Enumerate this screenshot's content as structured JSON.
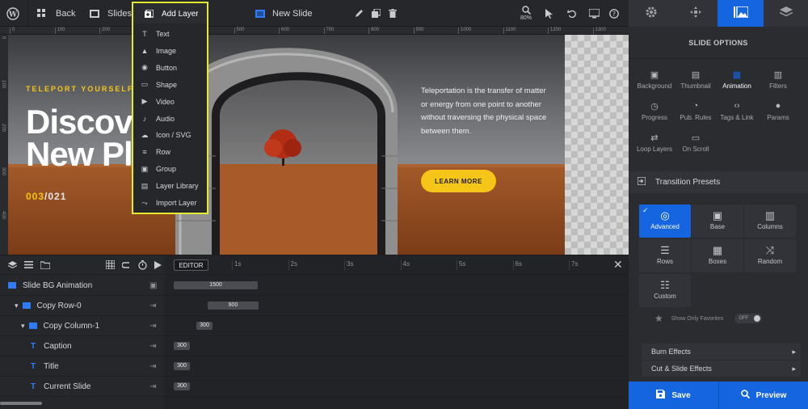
{
  "topbar": {
    "back_label": "Back",
    "slides_label": "Slides",
    "add_layer_label": "Add Layer",
    "new_slide_label": "New Slide",
    "zoom": "80%"
  },
  "ruler": {
    "h_ticks": [
      "0",
      "100",
      "200",
      "300",
      "400",
      "500",
      "600",
      "700",
      "800",
      "900",
      "1000",
      "1100",
      "1200",
      "1300"
    ],
    "v_ticks": [
      "0",
      "100",
      "200",
      "300",
      "400",
      "500"
    ]
  },
  "add_layer_menu": {
    "items": [
      {
        "label": "Text",
        "icon": "text-icon"
      },
      {
        "label": "Image",
        "icon": "image-icon"
      },
      {
        "label": "Button",
        "icon": "button-icon"
      },
      {
        "label": "Shape",
        "icon": "shape-icon"
      },
      {
        "label": "Video",
        "icon": "video-icon"
      },
      {
        "label": "Audio",
        "icon": "audio-icon"
      },
      {
        "label": "Icon / SVG",
        "icon": "icon-svg-icon"
      },
      {
        "label": "Row",
        "icon": "row-icon"
      },
      {
        "label": "Group",
        "icon": "group-icon"
      },
      {
        "label": "Layer Library",
        "icon": "layer-library-icon"
      },
      {
        "label": "Import Layer",
        "icon": "import-layer-icon"
      }
    ]
  },
  "slide": {
    "caption": "TELEPORT YOURSELF",
    "title_line1": "Discover",
    "title_line2": "New Places",
    "counter_current": "003",
    "counter_sep": "/",
    "counter_total": "021",
    "body_text": "Teleportation is the transfer of matter or energy from one point to another without traversing the physical space between them.",
    "cta_label": "LEARN MORE",
    "accent": "#f5c518"
  },
  "timeline": {
    "editor_label": "EDITOR",
    "ticks": [
      "1s",
      "2s",
      "3s",
      "4s",
      "5s",
      "6s",
      "7s"
    ],
    "layers": [
      {
        "name": "Slide BG Animation",
        "value": "1500"
      },
      {
        "name": "Copy Row-0",
        "value": "900"
      },
      {
        "name": "Copy Column-1",
        "value": "300"
      },
      {
        "name": "Caption",
        "value": "300"
      },
      {
        "name": "Title",
        "value": "300"
      },
      {
        "name": "Current Slide",
        "value": "300"
      }
    ]
  },
  "panel": {
    "section_title": "SLIDE OPTIONS",
    "options": [
      {
        "label": "Background",
        "icon": "background-icon"
      },
      {
        "label": "Thumbnail",
        "icon": "thumbnail-icon"
      },
      {
        "label": "Animation",
        "icon": "animation-icon",
        "active": true
      },
      {
        "label": "Filters",
        "icon": "filters-icon"
      },
      {
        "label": "Progress",
        "icon": "progress-icon"
      },
      {
        "label": "Pub. Rules",
        "icon": "pub-rules-icon"
      },
      {
        "label": "Tags & Link",
        "icon": "tags-link-icon"
      },
      {
        "label": "Params",
        "icon": "params-icon"
      },
      {
        "label": "Loop Layers",
        "icon": "loop-layers-icon"
      },
      {
        "label": "On Scroll",
        "icon": "on-scroll-icon"
      }
    ],
    "presets_title": "Transition Presets",
    "presets": [
      {
        "label": "Advanced",
        "active": true
      },
      {
        "label": "Base"
      },
      {
        "label": "Columns"
      },
      {
        "label": "Rows"
      },
      {
        "label": "Boxes"
      },
      {
        "label": "Random"
      },
      {
        "label": "Custom"
      }
    ],
    "favorites_label": "Show Only Favorites",
    "favorites_toggle": "OFF",
    "effects": [
      "Burn Effects",
      "Cut & Slide Effects"
    ],
    "save_label": "Save",
    "preview_label": "Preview",
    "active_color": "#1565e0"
  }
}
